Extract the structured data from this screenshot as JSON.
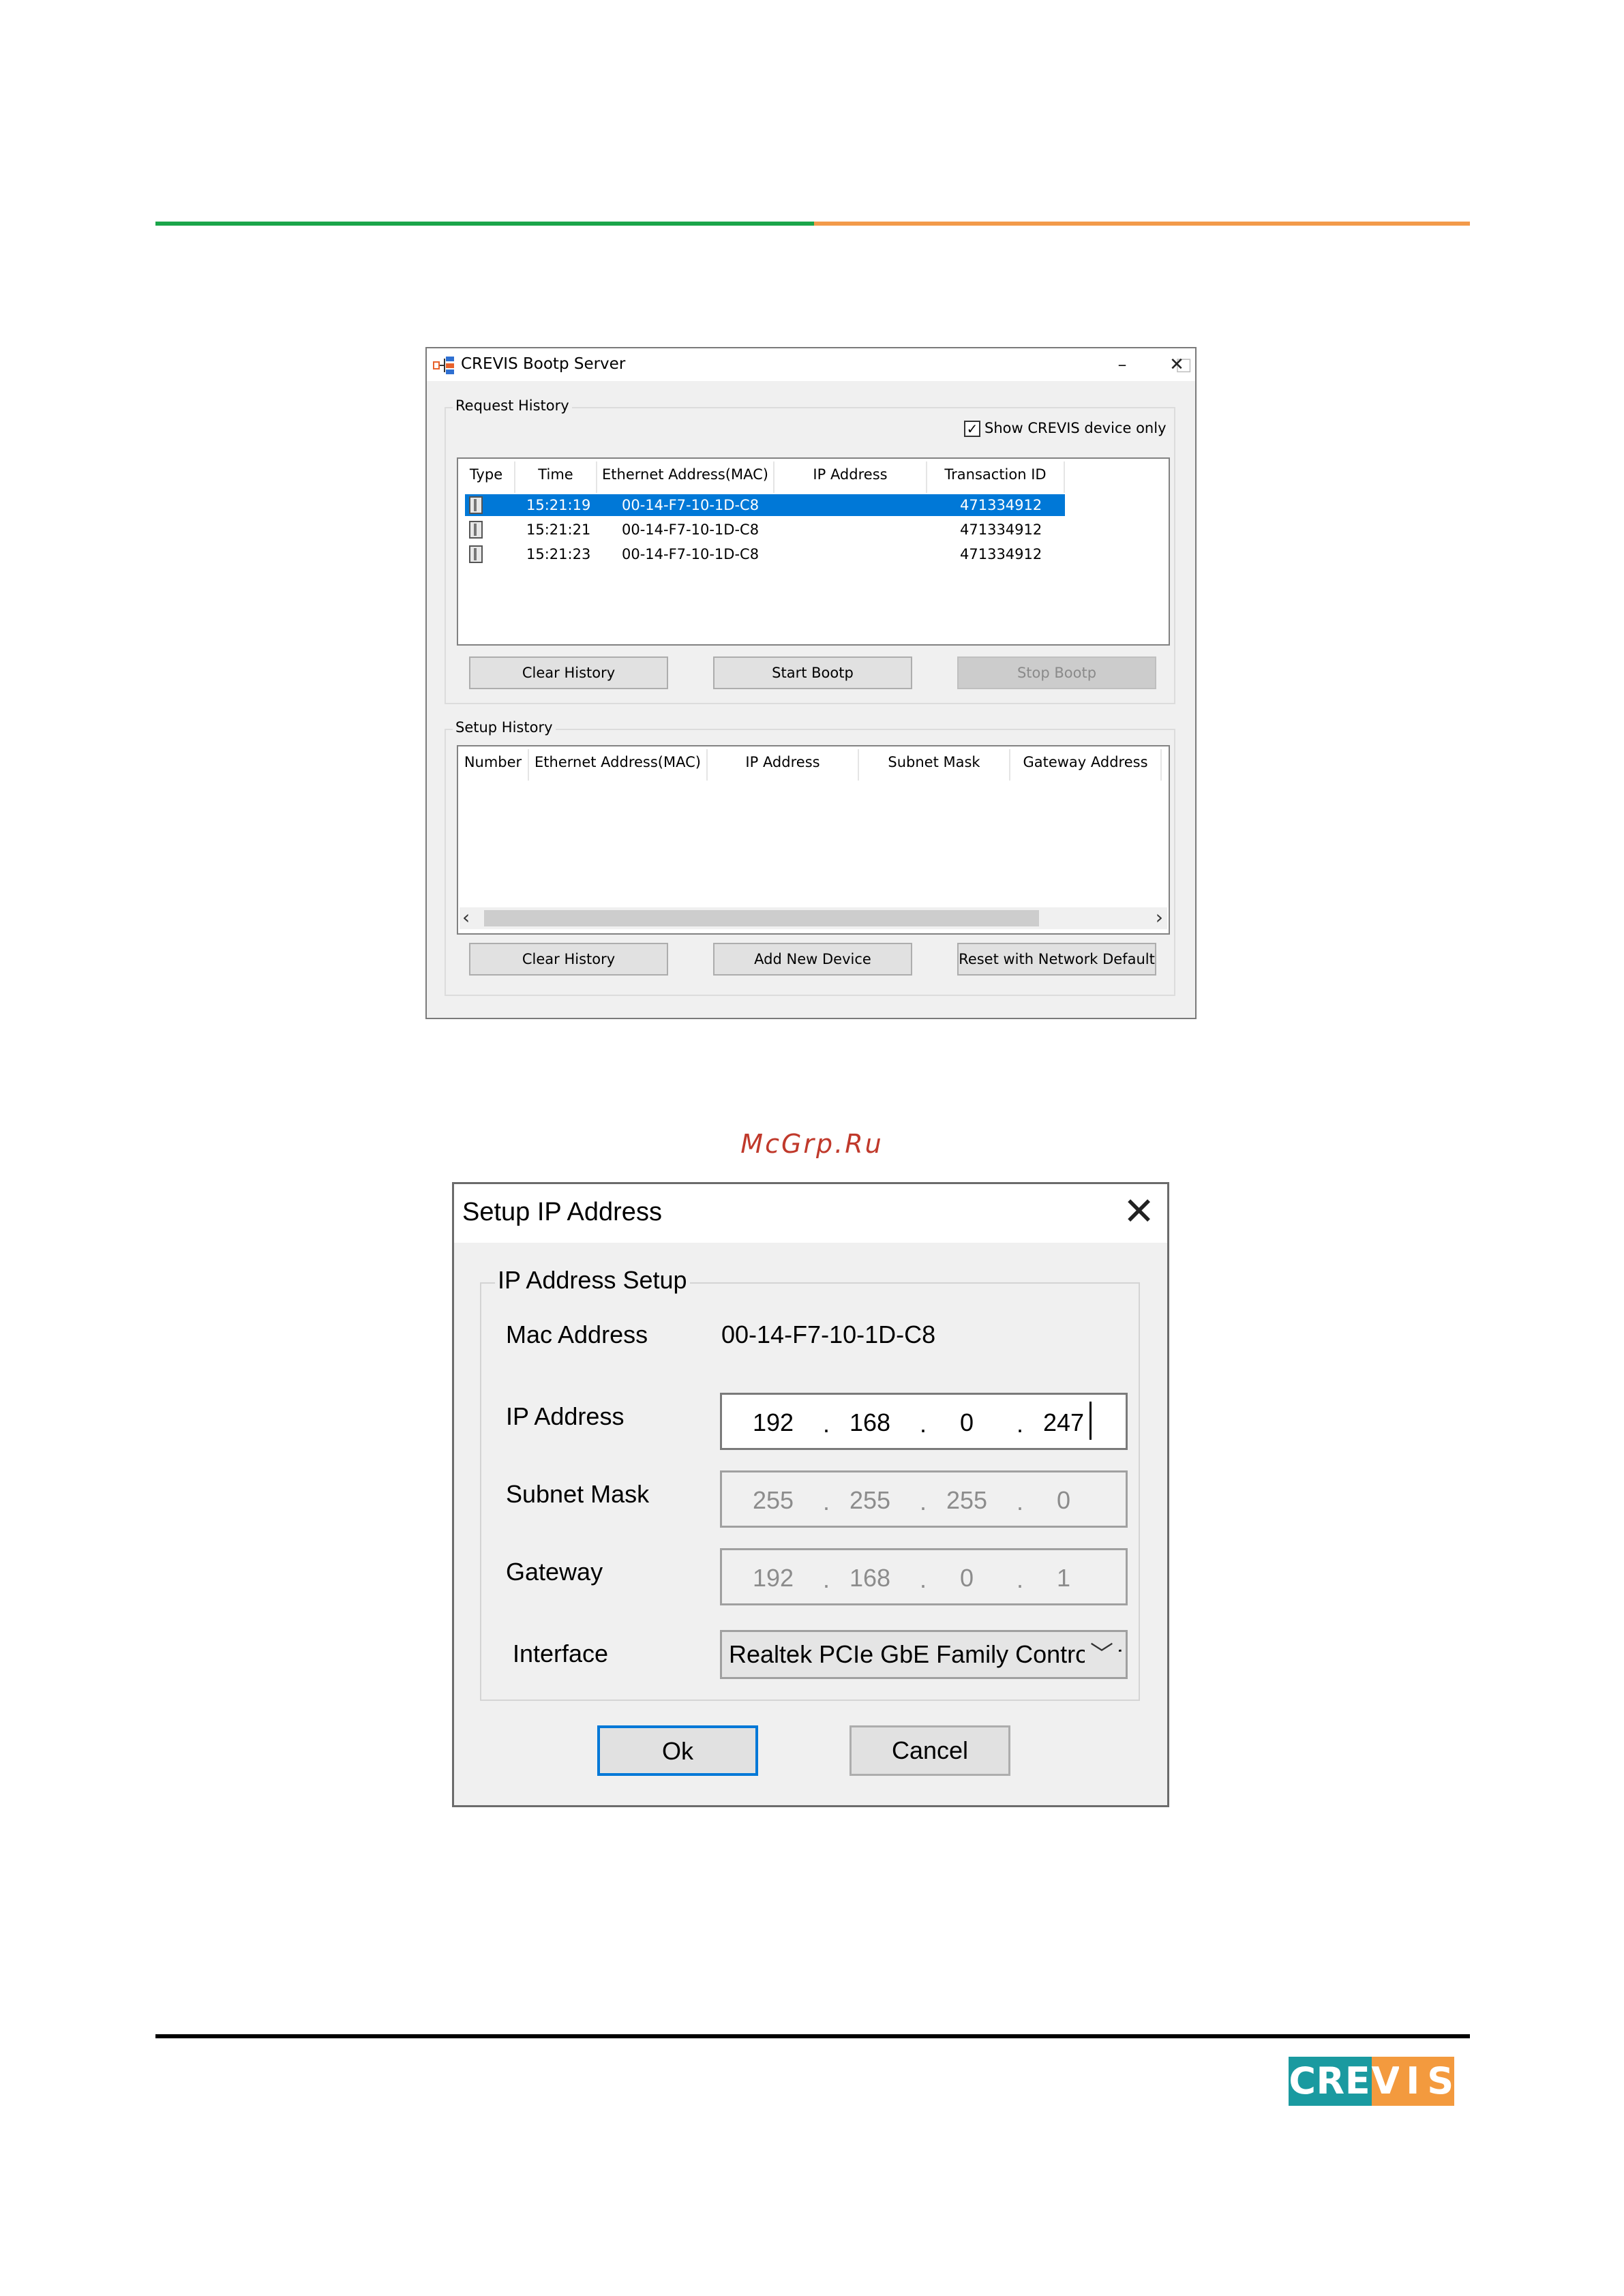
{
  "watermark": "McGrp.Ru",
  "logo": {
    "letters": [
      "C",
      "R",
      "E",
      "V",
      "I",
      "S"
    ],
    "colors": {
      "teal": "#1a9aa0",
      "orange": "#f39a3e"
    }
  },
  "colors": {
    "top_rule_green": "#1aa54a",
    "top_rule_orange": "#f39a4a",
    "selection": "#0078d7"
  },
  "bootp_window": {
    "title": "CREVIS Bootp Server",
    "app_icon": "network-tree-icon",
    "controls": {
      "minimize": "–",
      "maximize": "□",
      "close": "✕"
    },
    "request_history": {
      "label": "Request History",
      "show_crevis_only": {
        "label": "Show CREVIS device only",
        "checked": true,
        "mark": "✓"
      },
      "columns": [
        "Type",
        "Time",
        "Ethernet Address(MAC)",
        "IP Address",
        "Transaction ID"
      ],
      "rows": [
        {
          "time": "15:21:19",
          "mac": "00-14-F7-10-1D-C8",
          "ip": "",
          "tid": "471334912",
          "selected": true
        },
        {
          "time": "15:21:21",
          "mac": "00-14-F7-10-1D-C8",
          "ip": "",
          "tid": "471334912",
          "selected": false
        },
        {
          "time": "15:21:23",
          "mac": "00-14-F7-10-1D-C8",
          "ip": "",
          "tid": "471334912",
          "selected": false
        }
      ],
      "buttons": {
        "clear": "Clear History",
        "start": "Start Bootp",
        "stop": "Stop Bootp"
      }
    },
    "setup_history": {
      "label": "Setup History",
      "columns": [
        "Number",
        "Ethernet Address(MAC)",
        "IP Address",
        "Subnet Mask",
        "Gateway Address"
      ],
      "scroll_left": "‹",
      "scroll_right": "›",
      "buttons": {
        "clear": "Clear History",
        "add": "Add New Device",
        "reset": "Reset with Network Default"
      }
    }
  },
  "setup_dialog": {
    "title": "Setup IP Address",
    "close": "✕",
    "group_label": "IP Address Setup",
    "mac": {
      "label": "Mac Address",
      "value": "00-14-F7-10-1D-C8"
    },
    "ip": {
      "label": "IP Address",
      "octets": [
        "192",
        "168",
        "0",
        "247"
      ]
    },
    "subnet": {
      "label": "Subnet Mask",
      "octets": [
        "255",
        "255",
        "255",
        "0"
      ]
    },
    "gateway": {
      "label": "Gateway",
      "octets": [
        "192",
        "168",
        "0",
        "1"
      ]
    },
    "interface": {
      "label": "Interface",
      "value": "Realtek PCIe GbE Family Controller",
      "chevron": "﹀"
    },
    "buttons": {
      "ok": "Ok",
      "cancel": "Cancel"
    },
    "dot": "."
  }
}
